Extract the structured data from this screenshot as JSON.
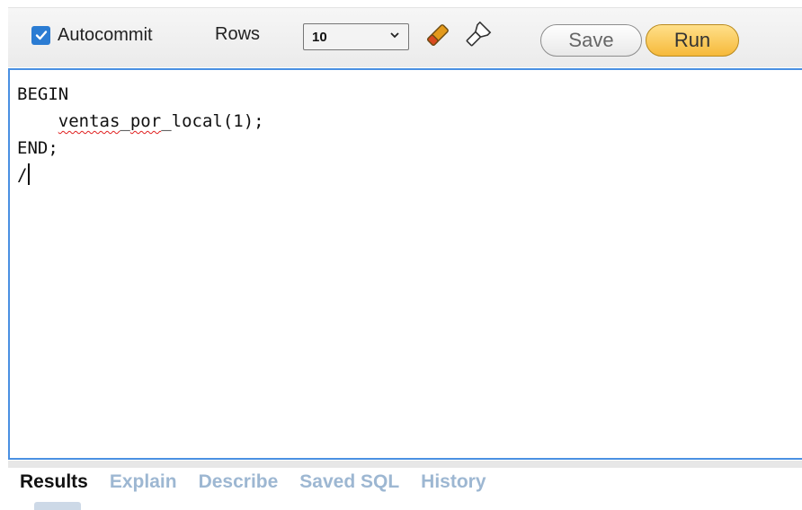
{
  "toolbar": {
    "autocommit": {
      "label": "Autocommit",
      "checked": true
    },
    "rows": {
      "label": "Rows",
      "value": "10"
    },
    "eraser_icon": "eraser-icon",
    "flashlight_icon": "flashlight-icon",
    "save_label": "Save",
    "run_label": "Run"
  },
  "editor": {
    "lines": [
      "BEGIN",
      "    ventas_por_local(1);",
      "END;",
      "/"
    ],
    "squiggle_words": [
      "ventas",
      "por"
    ]
  },
  "tabs": [
    {
      "label": "Results",
      "active": true
    },
    {
      "label": "Explain",
      "active": false
    },
    {
      "label": "Describe",
      "active": false
    },
    {
      "label": "Saved SQL",
      "active": false
    },
    {
      "label": "History",
      "active": false
    }
  ],
  "colors": {
    "accent": "#4a90e2",
    "run_button": "#f6b93a",
    "inactive_tab": "#9db7d2",
    "checkbox": "#2b7cd3"
  }
}
